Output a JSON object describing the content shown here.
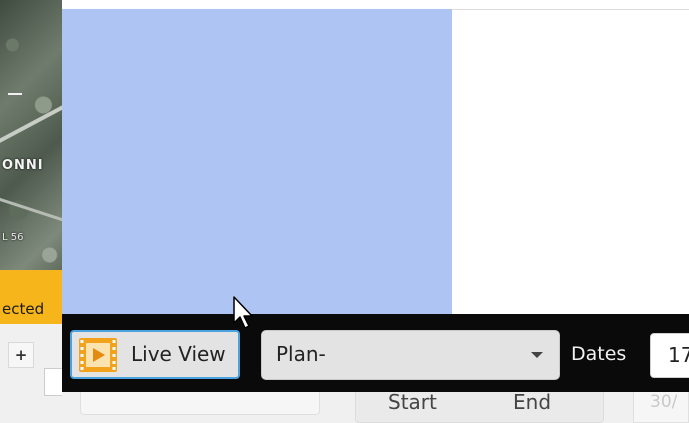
{
  "map": {
    "label_1": "ONNI",
    "label_2": "L 56"
  },
  "banner": {
    "text": "ected"
  },
  "left_panel": {
    "plus_label": "+"
  },
  "toolbar": {
    "live_view_label": "Live View",
    "live_view_icon": "film-play-icon",
    "plan_select_value": "Plan-",
    "dates_label": "Dates",
    "date_value": "17"
  },
  "columns": {
    "start": "Start",
    "end": "End",
    "faded_value": "30/"
  },
  "colors": {
    "selection_blue": "#aec4f2",
    "toolbar_black": "#0a0a0a",
    "accent_orange": "#f7b51c",
    "focus_blue": "#4aa3df"
  }
}
